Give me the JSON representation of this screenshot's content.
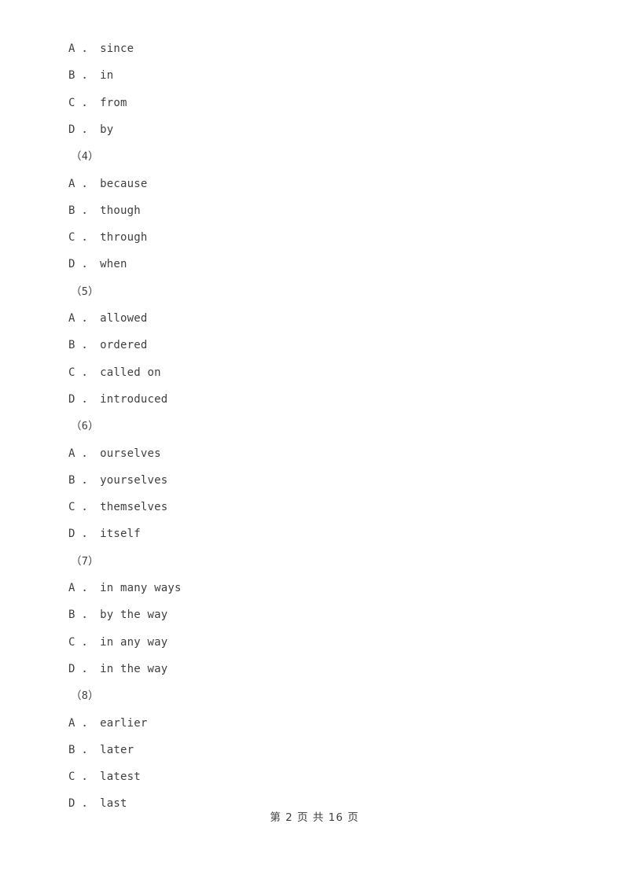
{
  "document": {
    "background_color": "#ffffff",
    "text_color": "#3f3f3f"
  },
  "blocks": [
    {
      "type": "options",
      "options": [
        {
          "letter": "A ．",
          "text": "since"
        },
        {
          "letter": "B ．",
          "text": "in"
        },
        {
          "letter": "C ．",
          "text": "from"
        },
        {
          "letter": "D ．",
          "text": "by"
        }
      ]
    },
    {
      "type": "question_number",
      "label": "（4）"
    },
    {
      "type": "options",
      "options": [
        {
          "letter": "A ．",
          "text": "because"
        },
        {
          "letter": "B ．",
          "text": "though"
        },
        {
          "letter": "C ．",
          "text": "through"
        },
        {
          "letter": "D ．",
          "text": "when"
        }
      ]
    },
    {
      "type": "question_number",
      "label": "（5）"
    },
    {
      "type": "options",
      "options": [
        {
          "letter": "A ．",
          "text": "allowed"
        },
        {
          "letter": "B ．",
          "text": "ordered"
        },
        {
          "letter": "C ．",
          "text": "called on"
        },
        {
          "letter": "D ．",
          "text": "introduced"
        }
      ]
    },
    {
      "type": "question_number",
      "label": "（6）"
    },
    {
      "type": "options",
      "options": [
        {
          "letter": "A ．",
          "text": "ourselves"
        },
        {
          "letter": "B ．",
          "text": "yourselves"
        },
        {
          "letter": "C ．",
          "text": "themselves"
        },
        {
          "letter": "D ．",
          "text": "itself"
        }
      ]
    },
    {
      "type": "question_number",
      "label": "（7）"
    },
    {
      "type": "options",
      "options": [
        {
          "letter": "A ．",
          "text": "in many ways"
        },
        {
          "letter": "B ．",
          "text": "by the way"
        },
        {
          "letter": "C ．",
          "text": "in any way"
        },
        {
          "letter": "D ．",
          "text": "in the way"
        }
      ]
    },
    {
      "type": "question_number",
      "label": "（8）"
    },
    {
      "type": "options",
      "options": [
        {
          "letter": "A ．",
          "text": "earlier"
        },
        {
          "letter": "B ．",
          "text": "later"
        },
        {
          "letter": "C ．",
          "text": "latest"
        },
        {
          "letter": "D ．",
          "text": "last"
        }
      ]
    }
  ],
  "footer": {
    "text": "第 2 页 共 16 页",
    "page_number": "2",
    "total_pages": "16"
  }
}
